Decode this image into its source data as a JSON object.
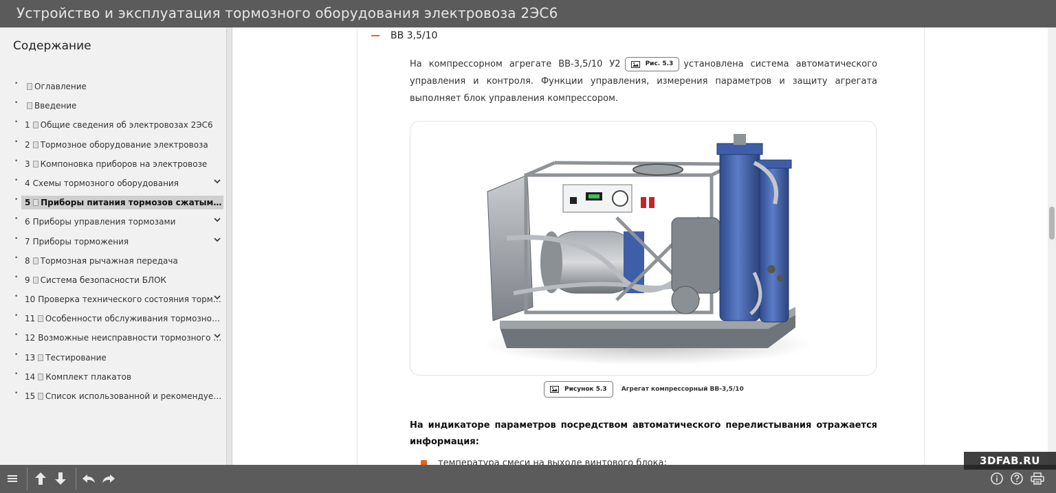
{
  "window": {
    "title": "Устройство и эксплуатация тормозного оборудования электровоза 2ЭС6"
  },
  "sidebar": {
    "heading": "Содержание",
    "items": [
      {
        "num": "",
        "label": "Оглавление",
        "has_doc": true,
        "expandable": false,
        "active": false
      },
      {
        "num": "",
        "label": "Введение",
        "has_doc": true,
        "expandable": false,
        "active": false
      },
      {
        "num": "1",
        "label": "Общие сведения об электровозах 2ЭС6",
        "has_doc": true,
        "expandable": false,
        "active": false
      },
      {
        "num": "2",
        "label": "Тормозное оборудование электровоза",
        "has_doc": true,
        "expandable": false,
        "active": false
      },
      {
        "num": "3",
        "label": "Компоновка приборов на электровозе",
        "has_doc": true,
        "expandable": false,
        "active": false
      },
      {
        "num": "4",
        "label": "Схемы тормозного оборудования",
        "has_doc": false,
        "expandable": true,
        "active": false
      },
      {
        "num": "5",
        "label": "Приборы питания тормозов сжатым в...",
        "has_doc": true,
        "expandable": false,
        "active": true
      },
      {
        "num": "6",
        "label": "Приборы управления тормозами",
        "has_doc": false,
        "expandable": true,
        "active": false
      },
      {
        "num": "7",
        "label": "Приборы торможения",
        "has_doc": false,
        "expandable": true,
        "active": false
      },
      {
        "num": "8",
        "label": "Тормозная рычажная передача",
        "has_doc": true,
        "expandable": false,
        "active": false
      },
      {
        "num": "9",
        "label": "Система безопасности БЛОК",
        "has_doc": true,
        "expandable": false,
        "active": false
      },
      {
        "num": "10",
        "label": "Проверка технического состояния тормо...",
        "has_doc": false,
        "expandable": true,
        "active": false
      },
      {
        "num": "11",
        "label": "Особенности обслуживания тормозного о...",
        "has_doc": true,
        "expandable": false,
        "active": false
      },
      {
        "num": "12",
        "label": "Возможные неисправности тормозного о...",
        "has_doc": false,
        "expandable": true,
        "active": false
      },
      {
        "num": "13",
        "label": "Тестирование",
        "has_doc": true,
        "expandable": false,
        "active": false
      },
      {
        "num": "14",
        "label": "Комплект плакатов",
        "has_doc": true,
        "expandable": false,
        "active": false
      },
      {
        "num": "15",
        "label": "Список использованной и рекомендуемой...",
        "has_doc": true,
        "expandable": false,
        "active": false
      }
    ]
  },
  "content": {
    "section_title": "ВВ 3,5/10",
    "para_before_chip": "На компрессорном агрегате ВВ-3,5/10 У2",
    "para_chip": "Рис. 5.3",
    "para_after_chip": "установлена система автоматического управления и контроля. Функции управления, измерения параметров и защиту агрегата выполняет блок управления компрессором.",
    "figure_chip": "Рисунок 5.3",
    "figure_caption": "Агрегат компрессорный ВВ-3,5/10",
    "bold_paragraph": "На индикаторе параметров посредством автоматического перелистывания отражается информация:",
    "list_first": "температура смеси на выходе винтового блока;"
  },
  "watermark": "3DFAB.RU",
  "colors": {
    "accent": "#e8631a",
    "titlebar": "#5b5b5b",
    "sidebar_bg": "#f1f1f1",
    "active_item_bg": "#cfcfcf",
    "compressor_blue": "#3e5fa8"
  }
}
